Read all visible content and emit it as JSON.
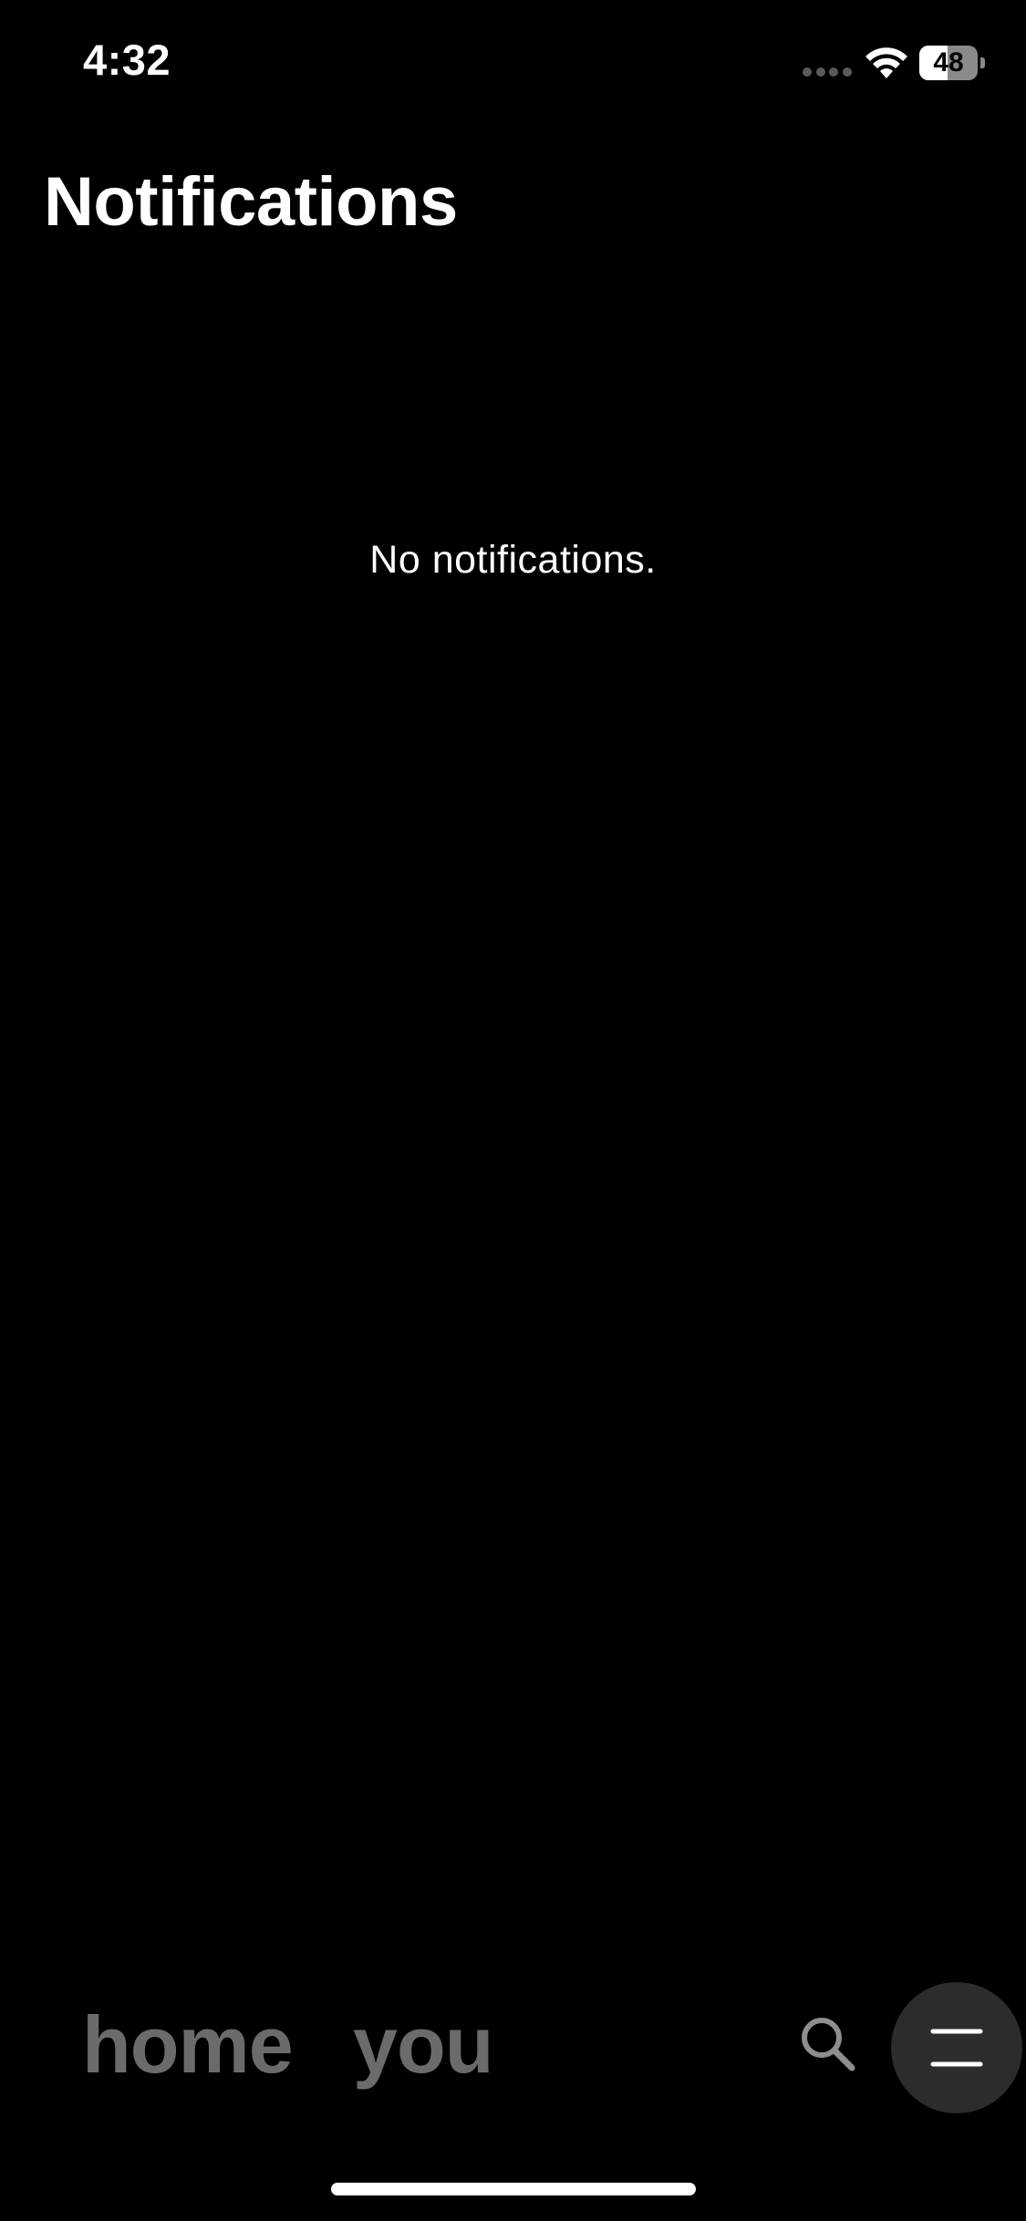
{
  "status_bar": {
    "time": "4:32",
    "battery_level": "48",
    "battery_fraction": 0.48,
    "signal_icon": "signal-dots-icon",
    "wifi_icon": "wifi-icon"
  },
  "header": {
    "title": "Notifications"
  },
  "main": {
    "empty_message": "No notifications."
  },
  "bottom_nav": {
    "tabs": [
      {
        "label": "home"
      },
      {
        "label": "you"
      }
    ],
    "search_icon": "search-icon",
    "menu_icon": "menu-icon"
  },
  "colors": {
    "background": "#000000",
    "text_primary": "#ffffff",
    "nav_inactive": "#6b6b6b",
    "menu_button_bg": "#2c2c2e"
  }
}
